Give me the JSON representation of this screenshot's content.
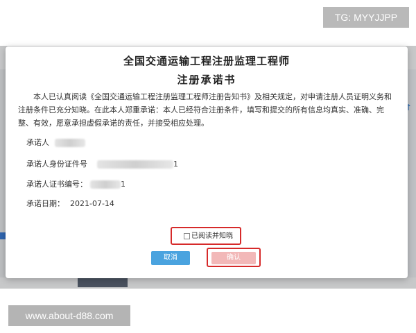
{
  "badges": {
    "tg": "TG: MYYJJPP",
    "site": "www.about-d88.com"
  },
  "modal": {
    "title": "全国交通运输工程注册监理工程师",
    "subtitle": "注册承诺书",
    "statement": "本人已认真阅读《全国交通运输工程注册监理工程师注册告知书》及相关规定，对申请注册人员证明义务和注册条件已充分知晓。在此本人郑重承诺：本人已经符合注册条件，填写和提交的所有信息均真实、准确、完整、有效，愿意承担虚假承诺的责任，并接受相应处理。",
    "fields": {
      "promisor_label": "承诺人",
      "id_label": "承诺人身份证件号",
      "id_tail": "1",
      "cert_label": "承诺人证书编号：",
      "cert_tail": "1",
      "date_label": "承诺日期：",
      "date_value": "2021-07-14"
    },
    "agree_label": "已阅读并知晓",
    "agree_checked": false,
    "cancel_label": "取消",
    "confirm_label": "确认"
  },
  "colors": {
    "highlight_border": "#d62a2a",
    "cancel_button": "#4aa3df",
    "confirm_button_disabled": "#f2b8b8"
  }
}
